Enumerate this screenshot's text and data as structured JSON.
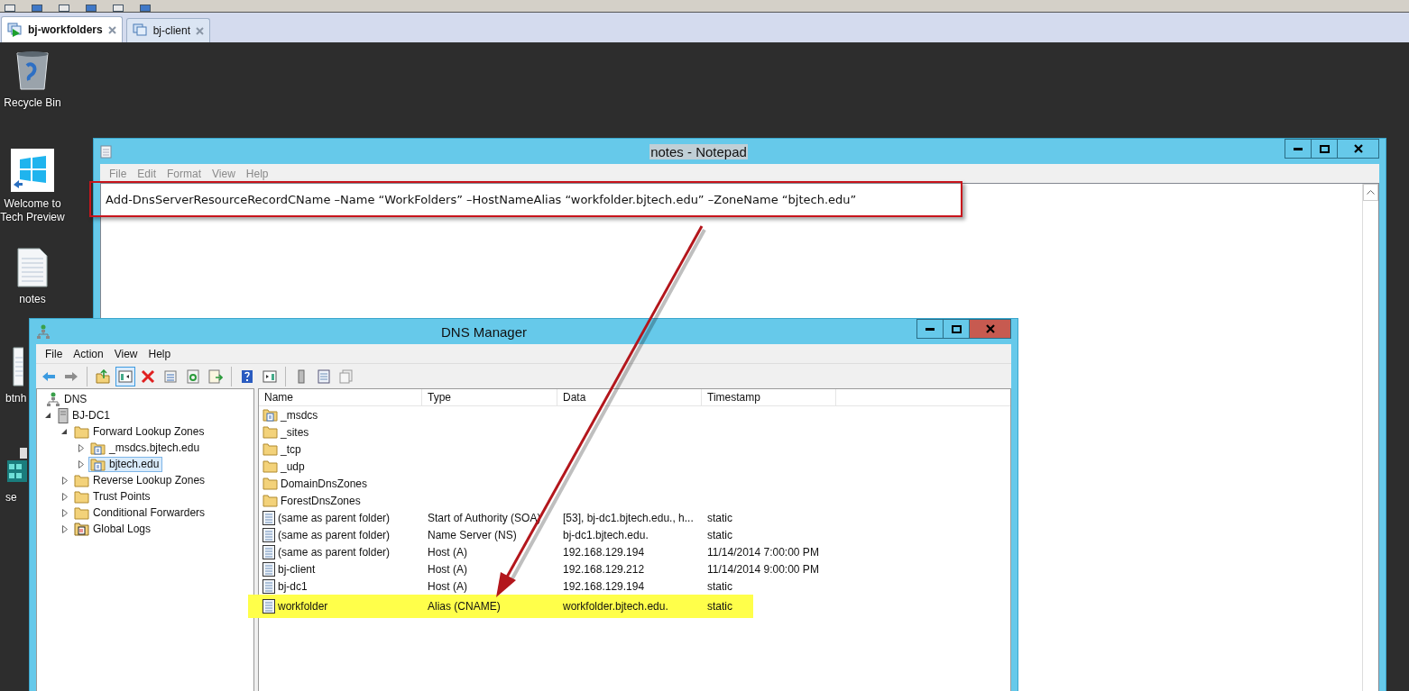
{
  "host_tabs": [
    {
      "label": "bj-workfolders",
      "selected": true
    },
    {
      "label": "bj-client",
      "selected": false
    }
  ],
  "desktop_icons": [
    {
      "label": "Recycle Bin",
      "kind": "recycle"
    },
    {
      "label": "Welcome to Tech Preview",
      "kind": "windows"
    },
    {
      "label": "notes",
      "kind": "text"
    },
    {
      "label": "btnh",
      "kind": "text-partial"
    },
    {
      "label": "se",
      "kind": "network-partial"
    }
  ],
  "notepad": {
    "title": "notes - Notepad",
    "menu": [
      "File",
      "Edit",
      "Format",
      "View",
      "Help"
    ],
    "content": "Add-DnsServerResourceRecordCName –Name “WorkFolders” –HostNameAlias “workfolder.bjtech.edu” –ZoneName “bjtech.edu”"
  },
  "dns_manager": {
    "title": "DNS Manager",
    "menu": [
      "File",
      "Action",
      "View",
      "Help"
    ],
    "tree": [
      {
        "label": "DNS",
        "kind": "root",
        "expanded": true,
        "selected": false,
        "children": [
          {
            "label": "BJ-DC1",
            "kind": "server",
            "expanded": true,
            "selected": false,
            "children": [
              {
                "label": "Forward Lookup Zones",
                "kind": "folder",
                "expanded": true,
                "selected": false,
                "children": [
                  {
                    "label": "_msdcs.bjtech.edu",
                    "kind": "zone",
                    "expanded": false,
                    "selected": false
                  },
                  {
                    "label": "bjtech.edu",
                    "kind": "zone",
                    "expanded": false,
                    "selected": true
                  }
                ]
              },
              {
                "label": "Reverse Lookup Zones",
                "kind": "folder",
                "expanded": false,
                "selected": false
              },
              {
                "label": "Trust Points",
                "kind": "folder",
                "expanded": false,
                "selected": false
              },
              {
                "label": "Conditional Forwarders",
                "kind": "folder",
                "expanded": false,
                "selected": false
              },
              {
                "label": "Global Logs",
                "kind": "log",
                "expanded": false,
                "selected": false
              }
            ]
          }
        ]
      }
    ],
    "columns": [
      "Name",
      "Type",
      "Data",
      "Timestamp"
    ],
    "rows": [
      {
        "kind": "zone-folder",
        "name": "_msdcs",
        "highlighted": false
      },
      {
        "kind": "folder",
        "name": "_sites",
        "highlighted": false
      },
      {
        "kind": "folder",
        "name": "_tcp",
        "highlighted": false
      },
      {
        "kind": "folder",
        "name": "_udp",
        "highlighted": false
      },
      {
        "kind": "folder",
        "name": "DomainDnsZones",
        "highlighted": false
      },
      {
        "kind": "folder",
        "name": "ForestDnsZones",
        "highlighted": false
      },
      {
        "kind": "record",
        "name": "(same as parent folder)",
        "type": "Start of Authority (SOA)",
        "data": "[53], bj-dc1.bjtech.edu., h...",
        "timestamp": "static",
        "highlighted": false
      },
      {
        "kind": "record",
        "name": "(same as parent folder)",
        "type": "Name Server (NS)",
        "data": "bj-dc1.bjtech.edu.",
        "timestamp": "static",
        "highlighted": false
      },
      {
        "kind": "record",
        "name": "(same as parent folder)",
        "type": "Host (A)",
        "data": "192.168.129.194",
        "timestamp": "11/14/2014 7:00:00 PM",
        "highlighted": false
      },
      {
        "kind": "record",
        "name": "bj-client",
        "type": "Host (A)",
        "data": "192.168.129.212",
        "timestamp": "11/14/2014 9:00:00 PM",
        "highlighted": false
      },
      {
        "kind": "record",
        "name": "bj-dc1",
        "type": "Host (A)",
        "data": "192.168.129.194",
        "timestamp": "static",
        "highlighted": false
      },
      {
        "kind": "record",
        "name": "workfolder",
        "type": "Alias (CNAME)",
        "data": "workfolder.bjtech.edu.",
        "timestamp": "static",
        "highlighted": true
      }
    ]
  }
}
